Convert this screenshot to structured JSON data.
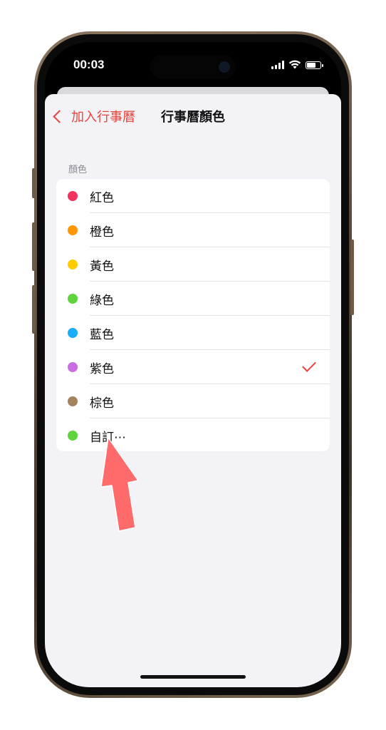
{
  "status_bar": {
    "time": "00:03"
  },
  "nav": {
    "back_label": "加入行事曆",
    "title": "行事曆顏色"
  },
  "section": {
    "header": "顏色"
  },
  "colors": [
    {
      "label": "紅色",
      "hex": "#f2325f",
      "selected": false
    },
    {
      "label": "橙色",
      "hex": "#ff9500",
      "selected": false
    },
    {
      "label": "黃色",
      "hex": "#ffcc00",
      "selected": false
    },
    {
      "label": "綠色",
      "hex": "#5fd33c",
      "selected": false
    },
    {
      "label": "藍色",
      "hex": "#1badf8",
      "selected": false
    },
    {
      "label": "紫色",
      "hex": "#c86ee0",
      "selected": true
    },
    {
      "label": "棕色",
      "hex": "#a2845e",
      "selected": false
    },
    {
      "label": "自訂⋯",
      "hex": "#5fd33c",
      "selected": false
    }
  ],
  "accent_color": "#e8453c",
  "annotation_arrow_color": "#ff6b6b"
}
